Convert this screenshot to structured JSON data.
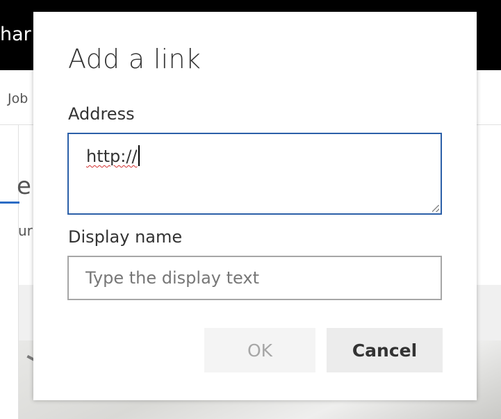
{
  "background": {
    "site_title": "har",
    "nav_item": "Job",
    "heading_fragment": "e",
    "sub_fragment": "ur"
  },
  "dialog": {
    "title": "Add a link",
    "address_label": "Address",
    "address_value": "http://",
    "display_name_label": "Display name",
    "display_name_placeholder": "Type the display text",
    "display_name_value": "",
    "ok_label": "OK",
    "cancel_label": "Cancel"
  },
  "colors": {
    "topbar": "#000000",
    "focus_border": "#2b5fa8",
    "accent_underline": "#2b6cc4",
    "disabled_text": "#a6a6a6"
  }
}
